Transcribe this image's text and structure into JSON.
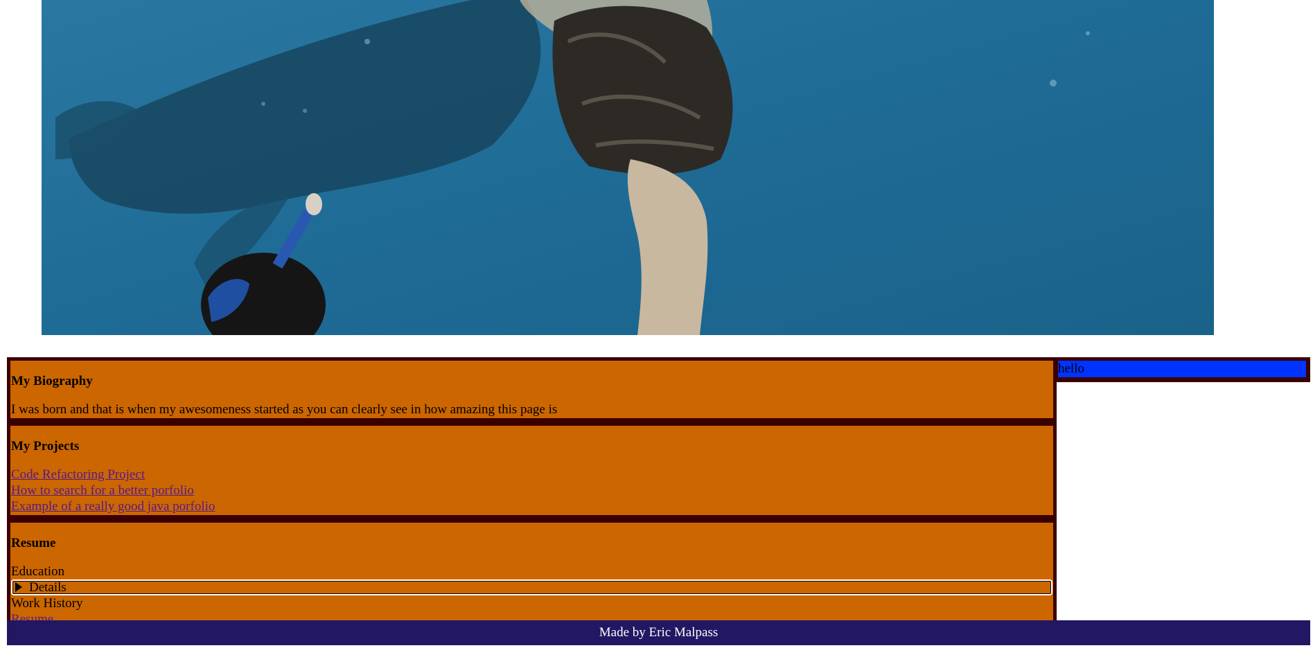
{
  "hero": {
    "image_icon": "underwater-snorkeling-photo",
    "colors": {
      "water": "#1e6b96",
      "skin": "#d8c4a8"
    }
  },
  "biography": {
    "heading": "My Biography",
    "text": "I was born and that is when my awesomeness started as you can clearly see in how amazing this page is"
  },
  "projects": {
    "heading": "My Projects",
    "links": [
      "Code Refactoring Project",
      "How to search for a better porfolio",
      "Example of a really good java porfolio"
    ]
  },
  "resume": {
    "heading": "Resume",
    "education_label": "Education",
    "details_label": "Details",
    "work_history_label": "Work History",
    "resume_link": "Resume"
  },
  "aside": {
    "text": "hello"
  },
  "footer": {
    "text": "Made by Eric Malpass"
  },
  "colors": {
    "section_bg": "#cc6600",
    "frame": "#3a0000",
    "aside_bg": "#0033ff",
    "footer_bg": "#211763",
    "link": "#551a8b"
  }
}
